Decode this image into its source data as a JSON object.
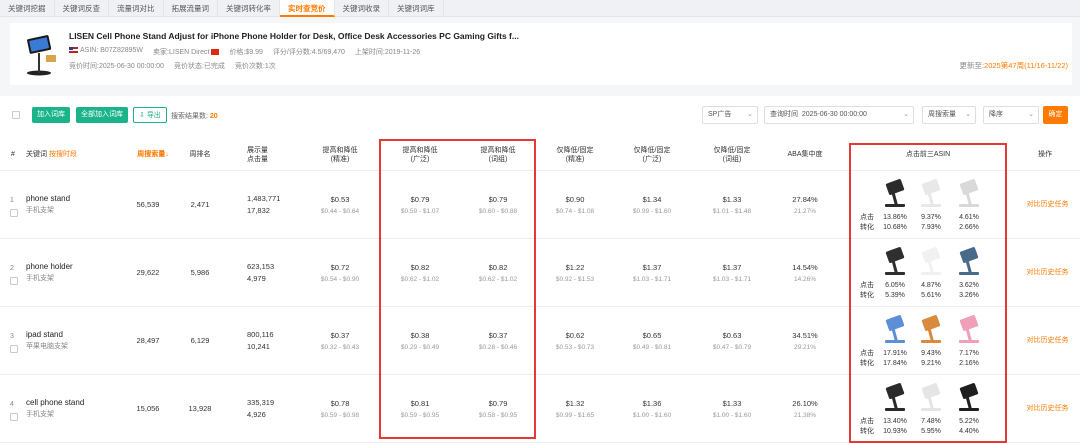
{
  "tabs": [
    {
      "label": "关键词挖掘"
    },
    {
      "label": "关键词反查"
    },
    {
      "label": "流量词对比"
    },
    {
      "label": "拓展流量词"
    },
    {
      "label": "关键词转化率"
    },
    {
      "label": "实时查竞价",
      "active": true
    },
    {
      "label": "关键词收录"
    },
    {
      "label": "关键词词库"
    }
  ],
  "product": {
    "title": "LISEN Cell Phone Stand Adjust for iPhone Phone Holder for Desk, Office Desk Accessories PC Gaming Gifts f...",
    "asin": "ASIN: B07Z82895W",
    "seller": "卖家:LISEN Direct",
    "price": "价格:$9.99",
    "rating": "评分/评分数:4.5/69,470",
    "listed": "上架时间:2019-11-26",
    "bid_time": "竞价时间:2025-06-30 00:00:00",
    "bid_status": "竞价状态:已完成",
    "bid_count": "竞价次数:1次",
    "updated_prefix": "更新至:",
    "updated_value": "2025第47周(11/16-11/22)"
  },
  "toolbar": {
    "add_btn": "加入词库",
    "add_all_btn": "全部加入词库",
    "export_btn": "导出",
    "result_label": "搜索结果数:",
    "result_count": "20",
    "ad_type": "SP广告",
    "query_time_label": "查询时间",
    "query_time_value": "2025-06-30 00:00:00",
    "sort_field": "周搜索量",
    "sort_order": "降序",
    "confirm_btn": "确定"
  },
  "headers": {
    "num": "#",
    "keyword": "关键词",
    "keyword_link": "按搜时段",
    "weekly_search": "周搜索量",
    "weekly_rank": "周排名",
    "impr_1": "展示量",
    "impr_2": "点击量",
    "up_down_exact_1": "提高和降低",
    "up_down_exact_2": "(精准)",
    "up_down_broad_1": "提高和降低",
    "up_down_broad_2": "(广泛)",
    "up_down_phrase_1": "提高和降低",
    "up_down_phrase_2": "(词组)",
    "down_exact_1": "仅降低/固定",
    "down_exact_2": "(精准)",
    "down_broad_1": "仅降低/固定",
    "down_broad_2": "(广泛)",
    "down_phrase_1": "仅降低/固定",
    "down_phrase_2": "(词组)",
    "aba": "ABA集中度",
    "top3": "点击前三ASIN",
    "action": "操作"
  },
  "asin_labels": {
    "click": "点击",
    "conv": "转化"
  },
  "rows": [
    {
      "index": "1",
      "kw": "phone stand",
      "kw_zh": "手机支架",
      "search": "56,539",
      "rank": "2,471",
      "impr": "1,483,771",
      "clicks": "17,832",
      "ude": "$0.53",
      "ude_r": "$0.44 - $0.64",
      "udb": "$0.79",
      "udb_r": "$0.59 - $1.07",
      "udp": "$0.79",
      "udp_r": "$0.60 - $0.88",
      "de": "$0.90",
      "de_r": "$0.74 - $1.08",
      "db": "$1.34",
      "db_r": "$0.99 - $1.60",
      "dp": "$1.33",
      "dp_r": "$1.01 - $1.48",
      "aba": "27.84%",
      "aba2": "21.27%",
      "asins": [
        {
          "c": "13.86%",
          "v": "10.68%"
        },
        {
          "c": "9.37%",
          "v": "7.93%"
        },
        {
          "c": "4.61%",
          "v": "2.66%"
        }
      ],
      "action": "对比历史任务"
    },
    {
      "index": "2",
      "kw": "phone holder",
      "kw_zh": "手机支架",
      "search": "29,622",
      "rank": "5,986",
      "impr": "623,153",
      "clicks": "4,979",
      "ude": "$0.72",
      "ude_r": "$0.54 - $0.90",
      "udb": "$0.82",
      "udb_r": "$0.62 - $1.02",
      "udp": "$0.82",
      "udp_r": "$0.62 - $1.02",
      "de": "$1.22",
      "de_r": "$0.92 - $1.53",
      "db": "$1.37",
      "db_r": "$1.03 - $1.71",
      "dp": "$1.37",
      "dp_r": "$1.03 - $1.71",
      "aba": "14.54%",
      "aba2": "14.26%",
      "asins": [
        {
          "c": "6.05%",
          "v": "5.39%"
        },
        {
          "c": "4.87%",
          "v": "5.61%"
        },
        {
          "c": "3.62%",
          "v": "3.26%"
        }
      ],
      "action": "对比历史任务"
    },
    {
      "index": "3",
      "kw": "ipad stand",
      "kw_zh": "苹果电脑支架",
      "search": "28,497",
      "rank": "6,129",
      "impr": "800,116",
      "clicks": "10,241",
      "ude": "$0.37",
      "ude_r": "$0.32 - $0.43",
      "udb": "$0.38",
      "udb_r": "$0.29 - $0.49",
      "udp": "$0.37",
      "udp_r": "$0.28 - $0.46",
      "de": "$0.62",
      "de_r": "$0.53 - $0.73",
      "db": "$0.65",
      "db_r": "$0.49 - $0.81",
      "dp": "$0.63",
      "dp_r": "$0.47 - $0.79",
      "aba": "34.51%",
      "aba2": "29.21%",
      "asins": [
        {
          "c": "17.91%",
          "v": "17.84%"
        },
        {
          "c": "9.43%",
          "v": "9.21%"
        },
        {
          "c": "7.17%",
          "v": "2.16%"
        }
      ],
      "action": "对比历史任务"
    },
    {
      "index": "4",
      "kw": "cell phone stand",
      "kw_zh": "手机支架",
      "search": "15,056",
      "rank": "13,928",
      "impr": "335,319",
      "clicks": "4,926",
      "ude": "$0.78",
      "ude_r": "$0.59 - $0.98",
      "udb": "$0.81",
      "udb_r": "$0.59 - $0.95",
      "udp": "$0.79",
      "udp_r": "$0.58 - $0.95",
      "de": "$1.32",
      "de_r": "$0.99 - $1.65",
      "db": "$1.36",
      "db_r": "$1.00 - $1.60",
      "dp": "$1.33",
      "dp_r": "$1.00 - $1.60",
      "aba": "26.10%",
      "aba2": "21.38%",
      "asins": [
        {
          "c": "13.40%",
          "v": "10.93%"
        },
        {
          "c": "7.48%",
          "v": "5.95%"
        },
        {
          "c": "5.22%",
          "v": "4.40%"
        }
      ],
      "action": "对比历史任务"
    }
  ]
}
